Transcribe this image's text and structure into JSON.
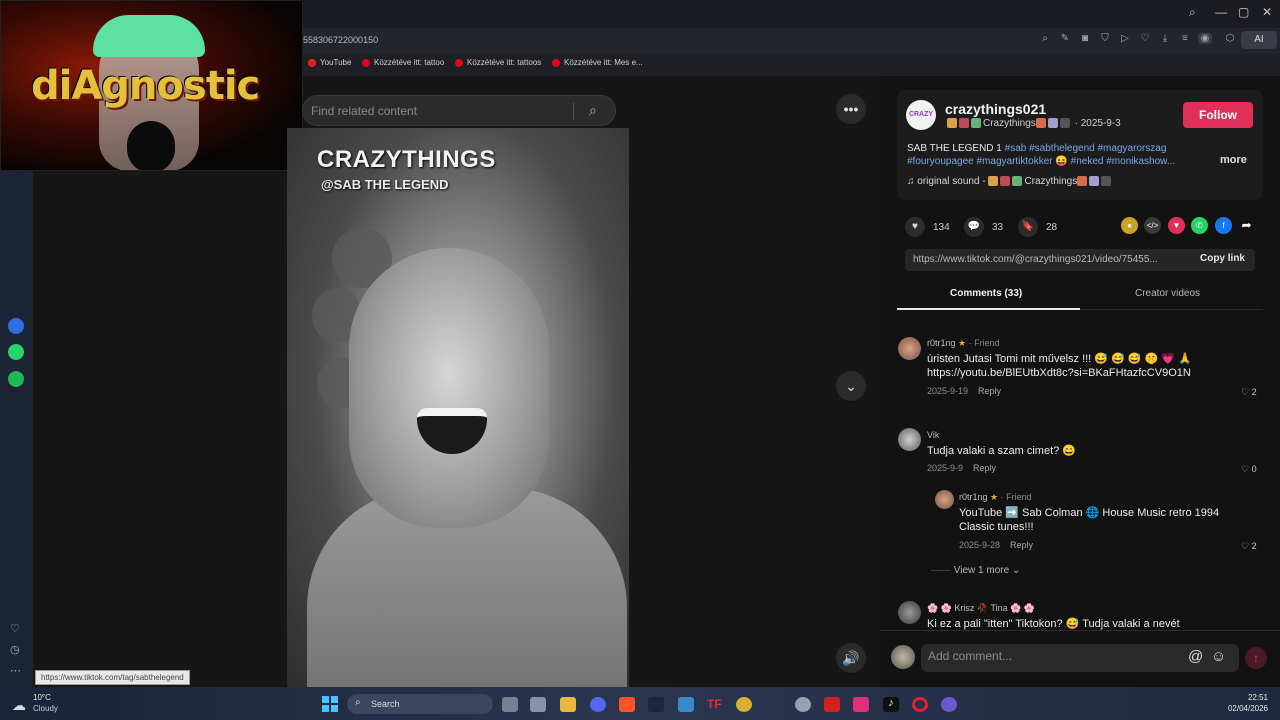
{
  "browser": {
    "url": "558306722000150",
    "bookmarks": [
      "YouTube",
      "Közzétéve itt: tattoo",
      "Közzétéve itt: tattoos",
      "Közzétéve itt: Mes e..."
    ],
    "ai_label": "AI"
  },
  "webcam": {
    "overlay_text": "diAgnostic"
  },
  "search": {
    "placeholder": "Find related content"
  },
  "video": {
    "title": "CRAZYTHINGS",
    "subtitle": "@SAB THE LEGEND"
  },
  "creator": {
    "username": "crazythings021",
    "display_name": "Crazythings",
    "date": "· 2025-9-3",
    "follow_label": "Follow",
    "caption_plain": "SAB THE LEGEND 1 ",
    "caption_tags_1": "#sab #sabthelegend #magyarorszag",
    "caption_tags_2": "#fouryoupagee #magyartiktokker",
    "caption_tags_3": "#neked #monikashow...",
    "more_label": "more",
    "sound_prefix": "original sound -",
    "sound_name": "Crazythings"
  },
  "stats": {
    "likes": "134",
    "comments": "33",
    "saves": "28"
  },
  "share": {
    "link": "https://www.tiktok.com/@crazythings021/video/75455...",
    "copy_label": "Copy link"
  },
  "tabs": {
    "comments": "Comments (33)",
    "creator_videos": "Creator videos"
  },
  "comments": [
    {
      "user": "r0tr1ng",
      "tag": "· Friend",
      "text": "úristen Jutasi Tomi mit művelsz !!! 😅 😅 😅 🤫 💗 🙏",
      "text2": "https://youtu.be/BlEUtbXdt8c?si=BKaFHtazfcCV9O1N",
      "date": "2025-9-19",
      "reply": "Reply",
      "likes": "2"
    },
    {
      "user": "Vik",
      "tag": "",
      "text": "Tudja valaki a szam cimet? 😄",
      "date": "2025-9-9",
      "reply": "Reply",
      "likes": "0"
    },
    {
      "user": "r0tr1ng",
      "tag": "· Friend",
      "text": "YouTube ➡️ Sab Colman 🌐 House Music retro 1994",
      "text2": "Classic tunes!!!",
      "date": "2025-9-28",
      "reply": "Reply",
      "likes": "2"
    },
    {
      "user": "🌸 🌸 Krisz 🥀 Tina 🌸 🌸",
      "tag": "",
      "text": "Ki ez a pali \"itten\" Tiktokon? 😅 Tudja valaki a nevét",
      "date": "",
      "reply": "",
      "likes": ""
    }
  ],
  "view_more": "View 1 more",
  "add_comment": {
    "placeholder": "Add comment..."
  },
  "status_url": "https://www.tiktok.com/tag/sabthelegend",
  "taskbar": {
    "temp": "10°C",
    "weather": "Cloudy",
    "search": "Search",
    "time": "22:51",
    "date": "02/04/2026"
  },
  "colors": {
    "accent": "#e0305a",
    "hashtag": "#7aa7e8",
    "taskbar": "#1a2438"
  }
}
